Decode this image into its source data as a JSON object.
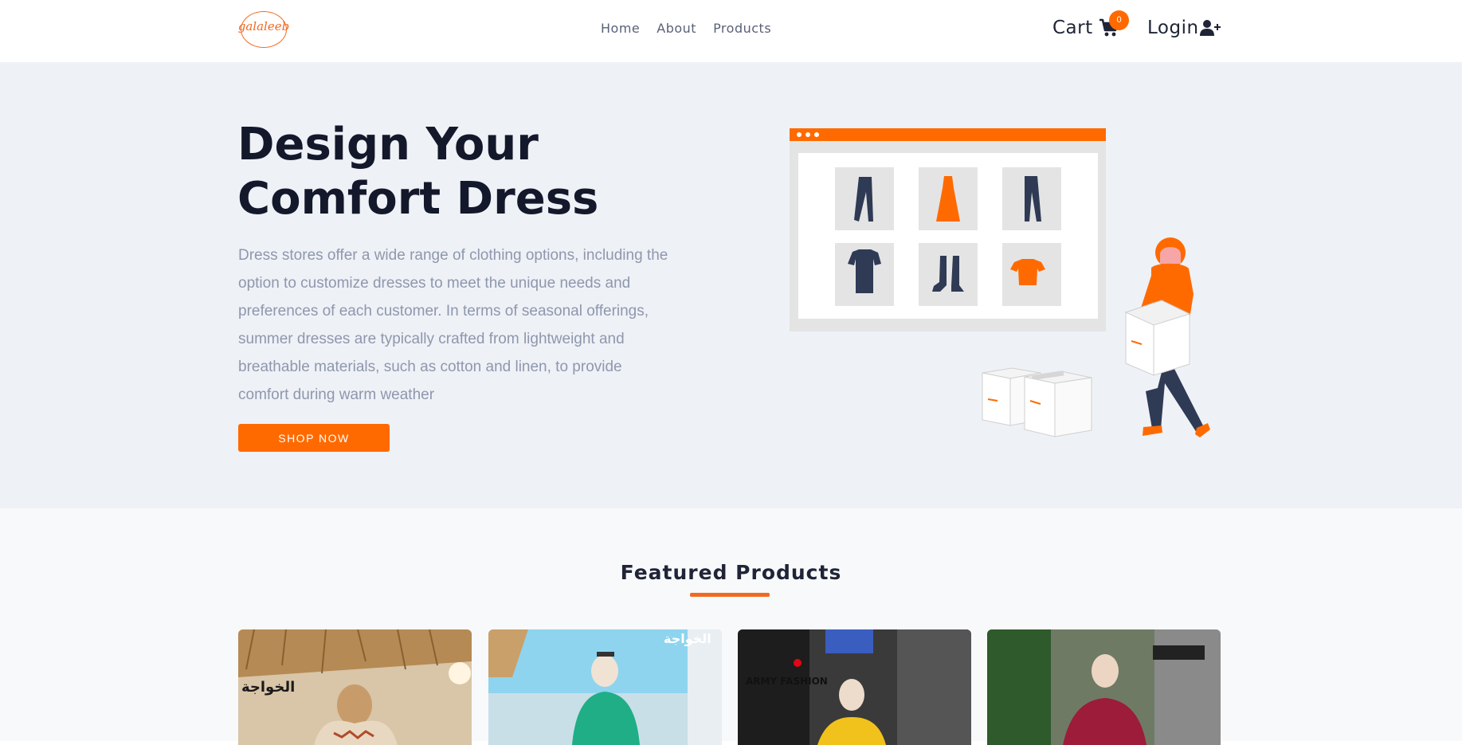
{
  "nav": {
    "logo_text": "galaleeb",
    "links": [
      "Home",
      "About",
      "Products"
    ],
    "cart_label": "Cart",
    "cart_count": "0",
    "login_label": "Login",
    "icons": {
      "cart": "cart-icon",
      "login": "user-plus-icon"
    }
  },
  "hero": {
    "title_line1": "Design Your",
    "title_line2": "Comfort Dress",
    "description": "Dress stores offer a wide range of clothing options, including the option to customize dresses to meet the unique needs and preferences of each customer. In terms of seasonal offerings, summer dresses are typically crafted from lightweight and breathable materials, such as cotton and linen, to provide comfort during warm weather",
    "button_label": "SHOP NOW"
  },
  "featured": {
    "title": "Featured Products",
    "products": [
      {
        "brand": "الخواجة"
      },
      {
        "brand": "الخواجة"
      },
      {
        "brand": "ARMY FASHION"
      },
      {
        "brand": ""
      }
    ]
  },
  "colors": {
    "accent": "#ff6a00",
    "hero_bg": "#eef1f6",
    "heading": "#14182b",
    "muted_text": "#8f97ad"
  }
}
